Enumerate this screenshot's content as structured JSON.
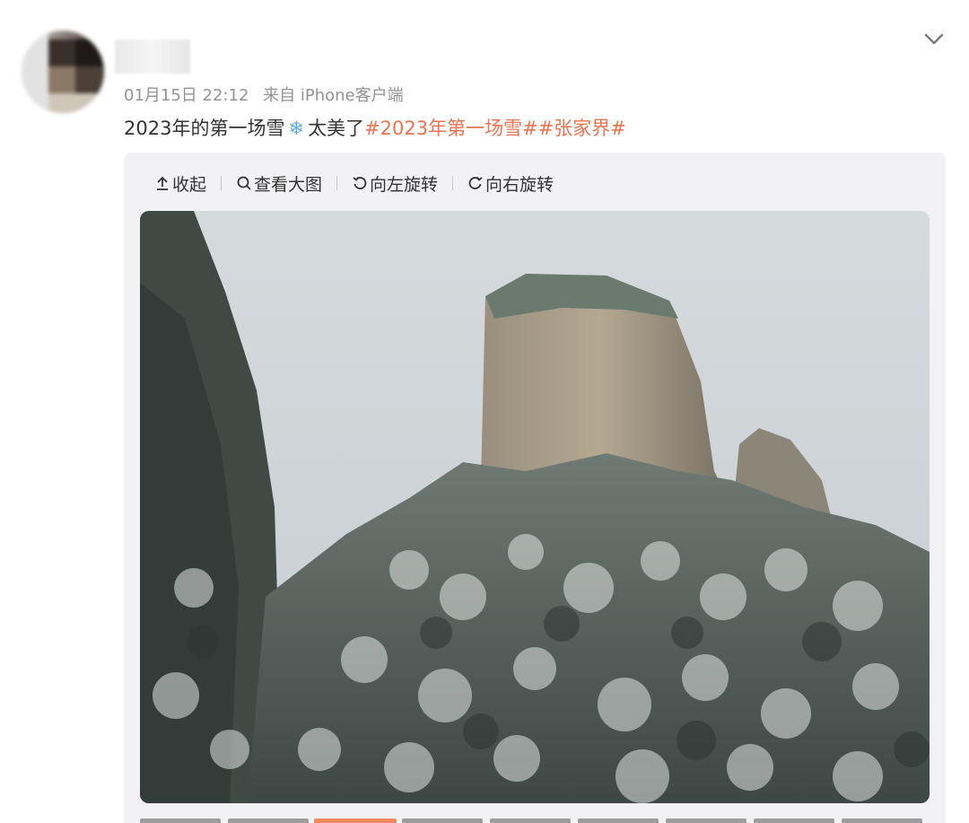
{
  "post": {
    "time": "01月15日 22:12",
    "source": "来自 iPhone客户端",
    "text_prefix": "2023年的第一场雪",
    "emoji": "❄",
    "text_suffix": "太美了",
    "hashtags": [
      "#2023年第一场雪#",
      "#张家界#"
    ]
  },
  "toolbar": {
    "collapse_label": "收起",
    "view_large_label": "查看大图",
    "rotate_left_label": "向左旋转",
    "rotate_right_label": "向右旋转"
  },
  "icons": {
    "menu": "chevron-down-icon",
    "collapse": "collapse-icon",
    "view_large": "search-icon",
    "rotate_left": "rotate-left-icon",
    "rotate_right": "rotate-right-icon"
  },
  "colors": {
    "hashtag": "#eb7350",
    "meta_text": "#939393",
    "body_text": "#333333",
    "media_bg": "#f2f2f5",
    "active_thumb": "#f08a5d"
  }
}
